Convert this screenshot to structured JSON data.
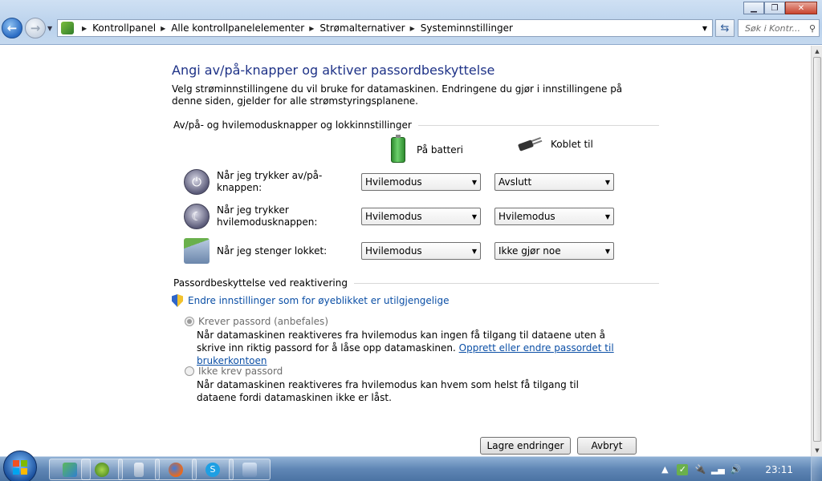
{
  "window": {
    "breadcrumbs": [
      "Kontrollpanel",
      "Alle kontrollpanelelementer",
      "Strømalternativer",
      "Systeminnstillinger"
    ],
    "search_placeholder": "Søk i Kontr..."
  },
  "page": {
    "title": "Angi av/på-knapper og aktiver passordbeskyttelse",
    "intro": "Velg strøminnstillingene du vil bruke for datamaskinen. Endringene du gjør i innstillingene på denne siden, gjelder for alle strømstyringsplanene.",
    "buttons_section_title": "Av/på- og hvilemodusknapper og lokkinnstillinger",
    "col_battery": "På batteri",
    "col_plugged": "Koblet til",
    "rows": [
      {
        "label": "Når jeg trykker av/på-knappen:",
        "battery": "Hvilemodus",
        "plugged": "Avslutt",
        "icon": "power-button-icon"
      },
      {
        "label": "Når jeg trykker hvilemodusknappen:",
        "battery": "Hvilemodus",
        "plugged": "Hvilemodus",
        "icon": "sleep-button-icon"
      },
      {
        "label": "Når jeg stenger lokket:",
        "battery": "Hvilemodus",
        "plugged": "Ikke gjør noe",
        "icon": "laptop-lid-icon"
      }
    ],
    "password_section_title": "Passordbeskyttelse ved reaktivering",
    "change_settings_link": "Endre innstillinger som for øyeblikket er utilgjengelige",
    "require_password_label": "Krever passord (anbefales)",
    "require_password_desc": "Når datamaskinen reaktiveres fra hvilemodus kan ingen få tilgang til dataene uten å skrive inn riktig passord for å låse opp datamaskinen.",
    "create_password_link": "Opprett eller endre passordet til brukerkontoen",
    "no_password_label": "Ikke krev passord",
    "no_password_desc": "Når datamaskinen reaktiveres fra hvilemodus kan hvem som helst få tilgang til dataene fordi datamaskinen ikke er låst.",
    "save_button": "Lagre endringer",
    "cancel_button": "Avbryt"
  },
  "taskbar": {
    "apps": [
      "people-icon",
      "spotify-icon",
      "calculator-icon",
      "firefox-icon",
      "skype-icon",
      "remote-desktop-icon"
    ],
    "clock": "23:11"
  },
  "colors": {
    "title": "#1e3287",
    "link": "#0b4fa6",
    "taskbar": "#5f86b5"
  }
}
